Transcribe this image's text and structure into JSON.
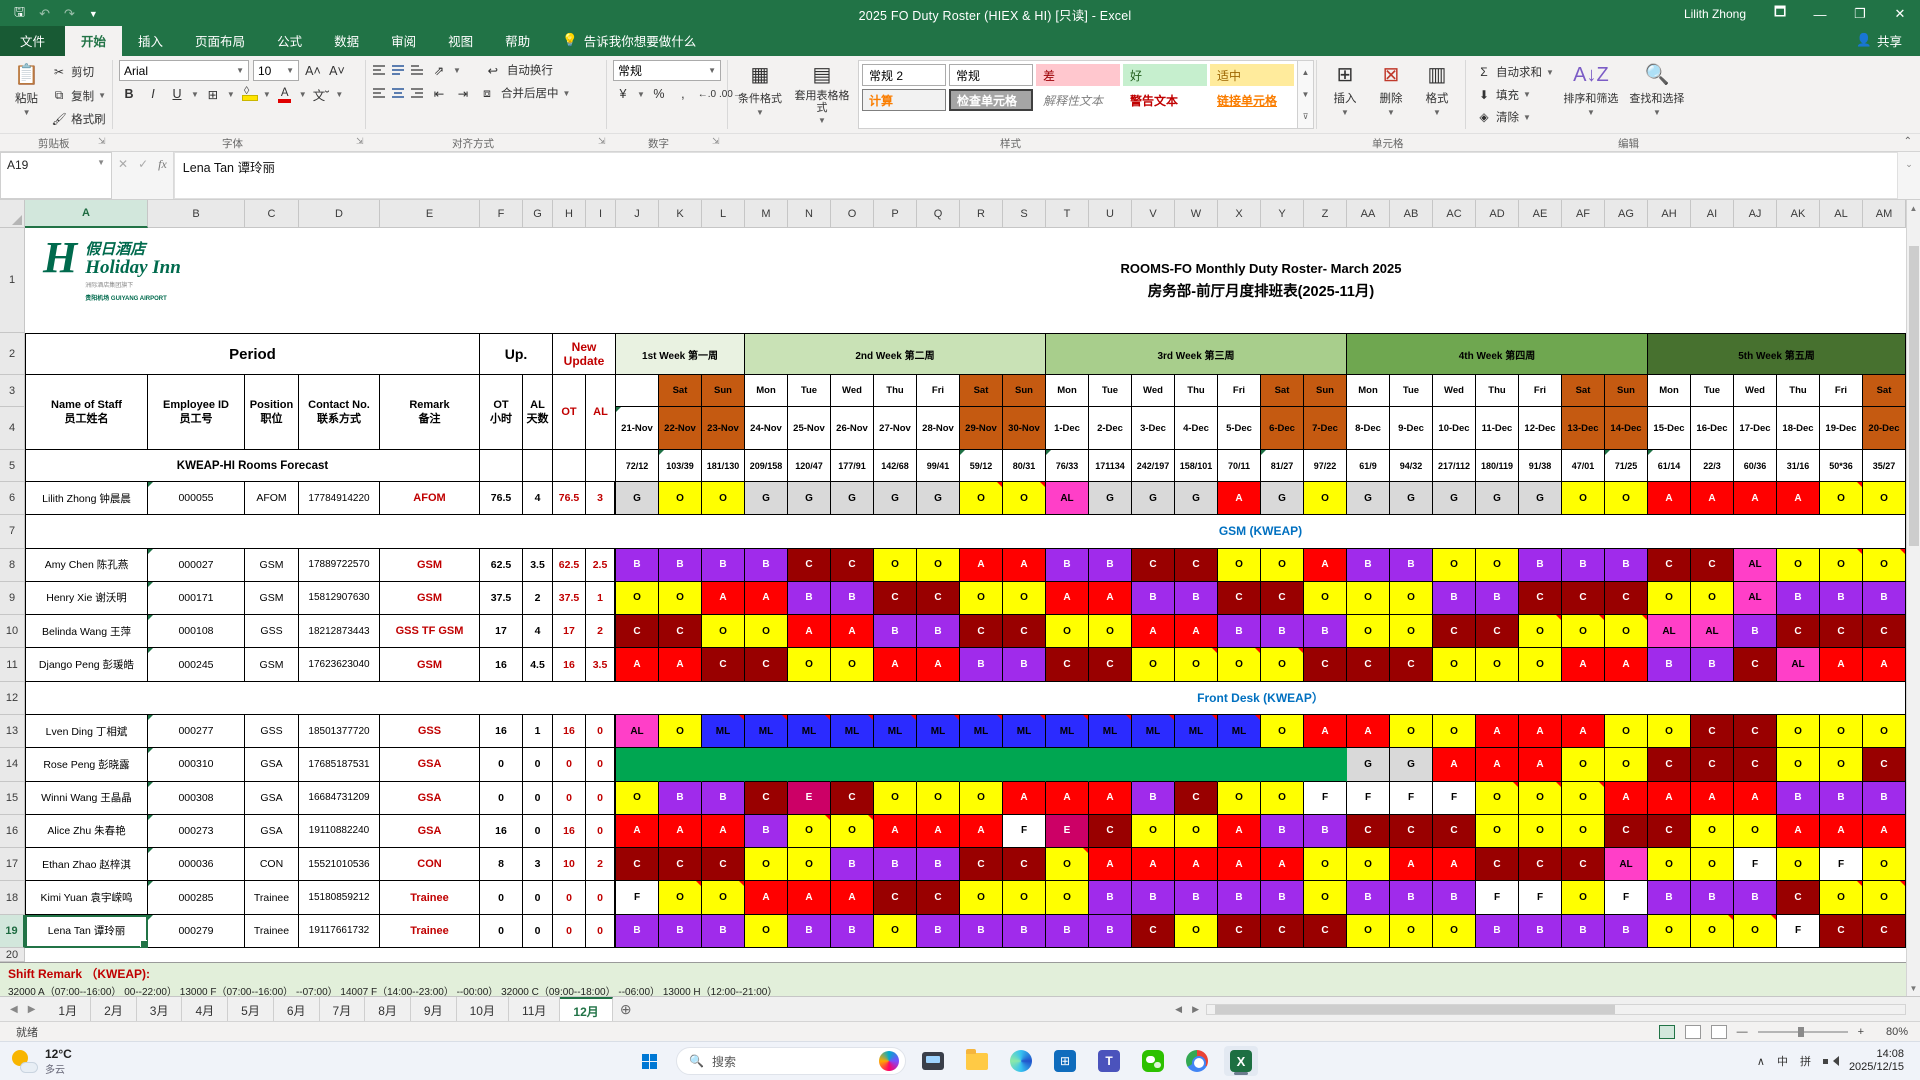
{
  "titlebar": {
    "title": "2025 FO Duty Roster (HIEX & HI)  [只读] -  Excel",
    "user": "Lilith Zhong",
    "save_icon": "save",
    "undo_icon": "undo",
    "redo_icon": "redo",
    "minimize": "—",
    "maximize": "❐",
    "close": "✕"
  },
  "ribbon_tabs": {
    "file": "文件",
    "tabs": [
      "开始",
      "插入",
      "页面布局",
      "公式",
      "数据",
      "审阅",
      "视图",
      "帮助"
    ],
    "active": "开始",
    "tellme": "告诉我你想要做什么",
    "share": "共享"
  },
  "ribbon": {
    "clipboard": {
      "paste": "粘贴",
      "cut": "剪切",
      "copy": "复制",
      "painter": "格式刷",
      "label": "剪贴板"
    },
    "font": {
      "family": "Arial",
      "size": "10",
      "label": "字体"
    },
    "align": {
      "wrap": "自动换行",
      "merge": "合并后居中",
      "label": "对齐方式"
    },
    "number": {
      "format": "常规",
      "label": "数字"
    },
    "styles": {
      "cond": "条件格式",
      "table": "套用表格格式",
      "label": "样式",
      "gallery": [
        "常规 2",
        "常规",
        "差",
        "好",
        "适中",
        "计算",
        "检查单元格",
        "解释性文本",
        "警告文本",
        "链接单元格"
      ]
    },
    "cells": {
      "insert": "插入",
      "delete": "删除",
      "format": "格式",
      "label": "单元格"
    },
    "editing": {
      "autosum": "自动求和",
      "fill": "填充",
      "clear": "清除",
      "sort": "排序和筛选",
      "find": "查找和选择",
      "label": "编辑"
    }
  },
  "formula_bar": {
    "name_box": "A19",
    "value": "Lena Tan 谭玲丽"
  },
  "sheet": {
    "title1": "ROOMS-FO Monthly Duty Roster- March 2025",
    "title2": "房务部-前厅月度排班表(2025-11月)",
    "logo": {
      "h": "H",
      "cn": "假日酒店",
      "en": "Holiday Inn",
      "sub1": "洲际酒店集团旗下",
      "sub2": "贵阳机场 GUIYANG AIRPORT"
    },
    "period_label": "Period",
    "up_label": "Up.",
    "new_update_label": "New Update",
    "forecast_label": "KWEAP-HI Rooms Forecast",
    "left_headers": [
      {
        "l1": "Name of Staff",
        "l2": "员工姓名"
      },
      {
        "l1": "Employee ID",
        "l2": "员工号"
      },
      {
        "l1": "Position",
        "l2": "职位"
      },
      {
        "l1": "Contact No.",
        "l2": "联系方式"
      },
      {
        "l1": "Remark",
        "l2": "备注"
      },
      {
        "l1": "OT",
        "l2": "小时"
      },
      {
        "l1": "AL",
        "l2": "天数"
      },
      {
        "l1": "OT",
        "l2": "",
        "red": true
      },
      {
        "l1": "AL",
        "l2": "",
        "red": true
      }
    ],
    "grid": {
      "col_letters": [
        "A",
        "B",
        "C",
        "D",
        "E",
        "F",
        "G",
        "H",
        "I",
        "J",
        "K",
        "L",
        "M",
        "N",
        "O",
        "P",
        "Q",
        "R",
        "S",
        "T",
        "U",
        "V",
        "W",
        "X",
        "Y",
        "Z",
        "AA",
        "AB",
        "AC",
        "AD",
        "AE",
        "AF",
        "AG",
        "AH",
        "AI",
        "AJ",
        "AK",
        "AL",
        "AM"
      ],
      "weeks": [
        {
          "label": "1st Week 第一周",
          "cols": 3,
          "color": "#e9f2e1"
        },
        {
          "label": "2nd Week 第二周",
          "cols": 7,
          "color": "#c9e2b6"
        },
        {
          "label": "3rd Week 第三周",
          "cols": 7,
          "color": "#a8ce8c"
        },
        {
          "label": "4th Week 第四周",
          "cols": 7,
          "color": "#6fa750"
        },
        {
          "label": "5th Week 第五周",
          "cols": 6,
          "color": "#47712f"
        }
      ],
      "days": [
        "",
        "Sat",
        "Sun",
        "Mon",
        "Tue",
        "Wed",
        "Thu",
        "Fri",
        "Sat",
        "Sun",
        "Mon",
        "Tue",
        "Wed",
        "Thu",
        "Fri",
        "Sat",
        "Sun",
        "Mon",
        "Tue",
        "Wed",
        "Thu",
        "Fri",
        "Sat",
        "Sun",
        "Mon",
        "Tue",
        "Wed",
        "Thu",
        "Fri",
        "Sat"
      ],
      "weekend_idx": [
        1,
        2,
        8,
        9,
        15,
        16,
        22,
        23,
        29
      ],
      "dates": [
        "21-Nov",
        "22-Nov",
        "23-Nov",
        "24-Nov",
        "25-Nov",
        "26-Nov",
        "27-Nov",
        "28-Nov",
        "29-Nov",
        "30-Nov",
        "1-Dec",
        "2-Dec",
        "3-Dec",
        "4-Dec",
        "5-Dec",
        "6-Dec",
        "7-Dec",
        "8-Dec",
        "9-Dec",
        "10-Dec",
        "11-Dec",
        "12-Dec",
        "13-Dec",
        "14-Dec",
        "15-Dec",
        "16-Dec",
        "17-Dec",
        "18-Dec",
        "19-Dec",
        "20-Dec"
      ],
      "forecast": [
        "72/12",
        "103/39",
        "181/130",
        "209/158",
        "120/47",
        "177/91",
        "142/68",
        "99/41",
        "59/12",
        "80/31",
        "76/33",
        "171134",
        "242/197",
        "158/101",
        "70/11",
        "81/27",
        "97/22",
        "61/9",
        "94/32",
        "217/112",
        "180/119",
        "91/38",
        "47/01",
        "71/25",
        "61/14",
        "22/3",
        "60/36",
        "31/16",
        "50*36",
        "35/27"
      ],
      "rows": [
        {
          "n": 6,
          "type": "staff",
          "name": "Lilith Zhong 钟晨晨",
          "id": "000055",
          "pos": "AFOM",
          "contact": "17784914220",
          "remark": "AFOM",
          "ot": "76.5",
          "al": "4",
          "nu_ot": "76.5",
          "nu_al": "3",
          "shifts": [
            "G",
            "O",
            "O",
            "G",
            "G",
            "G",
            "G",
            "G",
            "O",
            "O",
            "AL",
            "G",
            "G",
            "G",
            "A",
            "G",
            "O",
            "G",
            "G",
            "G",
            "G",
            "G",
            "O",
            "O",
            "A",
            "A",
            "A",
            "A",
            "O",
            "O"
          ],
          "flags": [
            8,
            9,
            28
          ]
        },
        {
          "n": 7,
          "type": "section",
          "label": "GSM (KWEAP)"
        },
        {
          "n": 8,
          "type": "staff",
          "name": "Amy Chen 陈孔燕",
          "id": "000027",
          "pos": "GSM",
          "contact": "17889722570",
          "remark": "GSM",
          "ot": "62.5",
          "al": "3.5",
          "nu_ot": "62.5",
          "nu_al": "2.5",
          "shifts": [
            "B",
            "B",
            "B",
            "B",
            "C",
            "C",
            "O",
            "O",
            "A",
            "A",
            "B",
            "B",
            "C",
            "C",
            "O",
            "O",
            "A",
            "B",
            "B",
            "O",
            "O",
            "B",
            "B",
            "B",
            "C",
            "C",
            "AL",
            "O",
            "O",
            "O"
          ],
          "flags": [
            28,
            29
          ]
        },
        {
          "n": 9,
          "type": "staff",
          "name": "Henry Xie 谢沃明",
          "id": "000171",
          "pos": "GSM",
          "contact": "15812907630",
          "remark": "GSM",
          "ot": "37.5",
          "al": "2",
          "nu_ot": "37.5",
          "nu_al": "1",
          "shifts": [
            "O",
            "O",
            "A",
            "A",
            "B",
            "B",
            "C",
            "C",
            "O",
            "O",
            "A",
            "A",
            "B",
            "B",
            "C",
            "C",
            "O",
            "O",
            "O",
            "B",
            "B",
            "C",
            "C",
            "C",
            "O",
            "O",
            "AL",
            "B",
            "B",
            "B"
          ],
          "flags": []
        },
        {
          "n": 10,
          "type": "staff",
          "name": "Belinda Wang 王萍",
          "id": "000108",
          "pos": "GSS",
          "contact": "18212873443",
          "remark": "GSS TF GSM",
          "ot": "17",
          "al": "4",
          "nu_ot": "17",
          "nu_al": "2",
          "shifts": [
            "C",
            "C",
            "O",
            "O",
            "A",
            "A",
            "B",
            "B",
            "C",
            "C",
            "O",
            "O",
            "A",
            "A",
            "B",
            "B",
            "B",
            "O",
            "O",
            "C",
            "C",
            "O",
            "O",
            "O",
            "AL",
            "AL",
            "B",
            "C",
            "C",
            "C"
          ],
          "flags": [
            21,
            22,
            23
          ]
        },
        {
          "n": 11,
          "type": "staff",
          "name": "Django Peng 彭瑗皓",
          "id": "000245",
          "pos": "GSM",
          "contact": "17623623040",
          "remark": "GSM",
          "ot": "16",
          "al": "4.5",
          "nu_ot": "16",
          "nu_al": "3.5",
          "shifts": [
            "A",
            "A",
            "C",
            "C",
            "O",
            "O",
            "A",
            "A",
            "B",
            "B",
            "C",
            "C",
            "O",
            "O",
            "O",
            "O",
            "C",
            "C",
            "C",
            "O",
            "O",
            "O",
            "A",
            "A",
            "B",
            "B",
            "C",
            "AL",
            "A",
            "A"
          ],
          "flags": [
            13,
            14,
            15
          ]
        },
        {
          "n": 12,
          "type": "section",
          "label": "Front Desk (KWEAP）"
        },
        {
          "n": 13,
          "type": "staff",
          "name": "Lven Ding 丁相斌",
          "id": "000277",
          "pos": "GSS",
          "contact": "18501377720",
          "remark": "GSS",
          "ot": "16",
          "al": "1",
          "nu_ot": "16",
          "nu_al": "0",
          "shifts": [
            "AL",
            "O",
            "ML",
            "ML",
            "ML",
            "ML",
            "ML",
            "ML",
            "ML",
            "ML",
            "ML",
            "ML",
            "ML",
            "ML",
            "ML",
            "O",
            "A",
            "A",
            "O",
            "O",
            "A",
            "A",
            "A",
            "O",
            "O",
            "C",
            "C",
            "O",
            "O",
            "O"
          ],
          "flags": [
            2,
            3,
            4,
            5,
            6,
            7,
            8,
            9,
            10,
            11,
            12,
            13,
            14
          ]
        },
        {
          "n": 14,
          "type": "staff",
          "name": "Rose Peng 彭晓露",
          "id": "000310",
          "pos": "GSA",
          "contact": "17685187531",
          "remark": "GSA",
          "ot": "0",
          "al": "0",
          "nu_ot": "0",
          "nu_al": "0",
          "shifts": [
            "X",
            "X",
            "X",
            "X",
            "X",
            "X",
            "X",
            "X",
            "X",
            "X",
            "X",
            "X",
            "X",
            "X",
            "X",
            "X",
            "X",
            "G",
            "G",
            "A",
            "A",
            "A",
            "O",
            "O",
            "C",
            "C",
            "C",
            "O",
            "O",
            "C"
          ],
          "flags": []
        },
        {
          "n": 15,
          "type": "staff",
          "name": "Winni Wang 王晶晶",
          "id": "000308",
          "pos": "GSA",
          "contact": "16684731209",
          "remark": "GSA",
          "ot": "0",
          "al": "0",
          "nu_ot": "0",
          "nu_al": "0",
          "shifts": [
            "O",
            "B",
            "B",
            "C",
            "E",
            "C",
            "O",
            "O",
            "O",
            "A",
            "A",
            "A",
            "B",
            "C",
            "O",
            "O",
            "F",
            "F",
            "F",
            "F",
            "O",
            "O",
            "O",
            "A",
            "A",
            "A",
            "A",
            "B",
            "B",
            "B"
          ],
          "flags": [
            20,
            21,
            22
          ]
        },
        {
          "n": 16,
          "type": "staff",
          "name": "Alice Zhu 朱春艳",
          "id": "000273",
          "pos": "GSA",
          "contact": "19110882240",
          "remark": "GSA",
          "ot": "16",
          "al": "0",
          "nu_ot": "16",
          "nu_al": "0",
          "shifts": [
            "A",
            "A",
            "A",
            "B",
            "O",
            "O",
            "A",
            "A",
            "A",
            "F",
            "E",
            "C",
            "O",
            "O",
            "A",
            "B",
            "B",
            "C",
            "C",
            "C",
            "O",
            "O",
            "O",
            "C",
            "C",
            "O",
            "O",
            "A",
            "A",
            "A"
          ],
          "flags": [
            4,
            5
          ]
        },
        {
          "n": 17,
          "type": "staff",
          "name": "Ethan Zhao 赵梓淇",
          "id": "000036",
          "pos": "CON",
          "contact": "15521010536",
          "remark": "CON",
          "ot": "8",
          "al": "3",
          "nu_ot": "10",
          "nu_al": "2",
          "shifts": [
            "C",
            "C",
            "C",
            "O",
            "O",
            "B",
            "B",
            "B",
            "C",
            "C",
            "O",
            "A",
            "A",
            "A",
            "A",
            "A",
            "O",
            "O",
            "A",
            "A",
            "C",
            "C",
            "C",
            "AL",
            "O",
            "O",
            "F",
            "O",
            "F",
            "O"
          ],
          "flags": [
            10
          ]
        },
        {
          "n": 18,
          "type": "staff",
          "name": "Kimi Yuan 袁宇嵘鸣",
          "id": "000285",
          "pos": "Trainee",
          "contact": "15180859212",
          "remark": "Trainee",
          "ot": "0",
          "al": "0",
          "nu_ot": "0",
          "nu_al": "0",
          "shifts": [
            "F",
            "O",
            "O",
            "A",
            "A",
            "A",
            "C",
            "C",
            "O",
            "O",
            "O",
            "B",
            "B",
            "B",
            "B",
            "B",
            "O",
            "B",
            "B",
            "B",
            "F",
            "F",
            "O",
            "F",
            "B",
            "B",
            "B",
            "C",
            "O",
            "O"
          ],
          "flags": [
            1,
            2,
            28,
            29
          ]
        },
        {
          "n": 19,
          "type": "staff",
          "name": "Lena Tan 谭玲丽",
          "id": "000279",
          "pos": "Trainee",
          "contact": "19117661732",
          "remark": "Trainee",
          "ot": "0",
          "al": "0",
          "nu_ot": "0",
          "nu_al": "0",
          "selected": true,
          "shifts": [
            "B",
            "B",
            "B",
            "O",
            "B",
            "B",
            "O",
            "B",
            "B",
            "B",
            "B",
            "B",
            "C",
            "O",
            "C",
            "C",
            "C",
            "O",
            "O",
            "O",
            "B",
            "B",
            "B",
            "B",
            "O",
            "O",
            "O",
            "F",
            "C",
            "C"
          ],
          "flags": [
            25,
            26
          ]
        }
      ]
    },
    "shift_colors": {
      "G": {
        "bg": "#d9d9d9",
        "fg": "#000000"
      },
      "O": {
        "bg": "#ffff00",
        "fg": "#000000"
      },
      "A": {
        "bg": "#ff0000",
        "fg": "#ffffff"
      },
      "B": {
        "bg": "#a02beb",
        "fg": "#ffffff"
      },
      "C": {
        "bg": "#990000",
        "fg": "#ffffff"
      },
      "AL": {
        "bg": "#ff3fc8",
        "fg": "#000000"
      },
      "ML": {
        "bg": "#2b2bff",
        "fg": "#000000"
      },
      "E": {
        "bg": "#cc0066",
        "fg": "#ffffff"
      },
      "F": {
        "bg": "#ffffff",
        "fg": "#000000"
      },
      "X": {
        "bg": "#00a651",
        "fg": "#00a651"
      }
    },
    "weekend_color": "#c55a11",
    "remark": {
      "line1": "Shift Remark （KWEAP):",
      "line2": "32000 A（07:00--16:00）    00--22:00）    13000 F（07:00--16:00）    --07:00）    14007 F（14:00--23:00）    --00:00）    32000 C（09:00--18:00）    --06:00）    13000 H（12:00--21:00）"
    }
  },
  "tabs": {
    "items": [
      "1月",
      "2月",
      "3月",
      "4月",
      "5月",
      "6月",
      "7月",
      "8月",
      "9月",
      "10月",
      "11月",
      "12月"
    ],
    "active": "12月",
    "add": "+"
  },
  "status_bar": {
    "ready": "就绪",
    "zoom": "80%"
  },
  "taskbar": {
    "weather": {
      "temp": "12°C",
      "cond": "多云"
    },
    "search_placeholder": "搜索",
    "icons": [
      "task-view",
      "file-explorer",
      "edge",
      "store",
      "teams",
      "wechat",
      "chrome",
      "excel"
    ],
    "active_icon": "excel",
    "ime1": "中",
    "ime2": "拼",
    "time": "14:08",
    "date": "2025/12/15"
  }
}
